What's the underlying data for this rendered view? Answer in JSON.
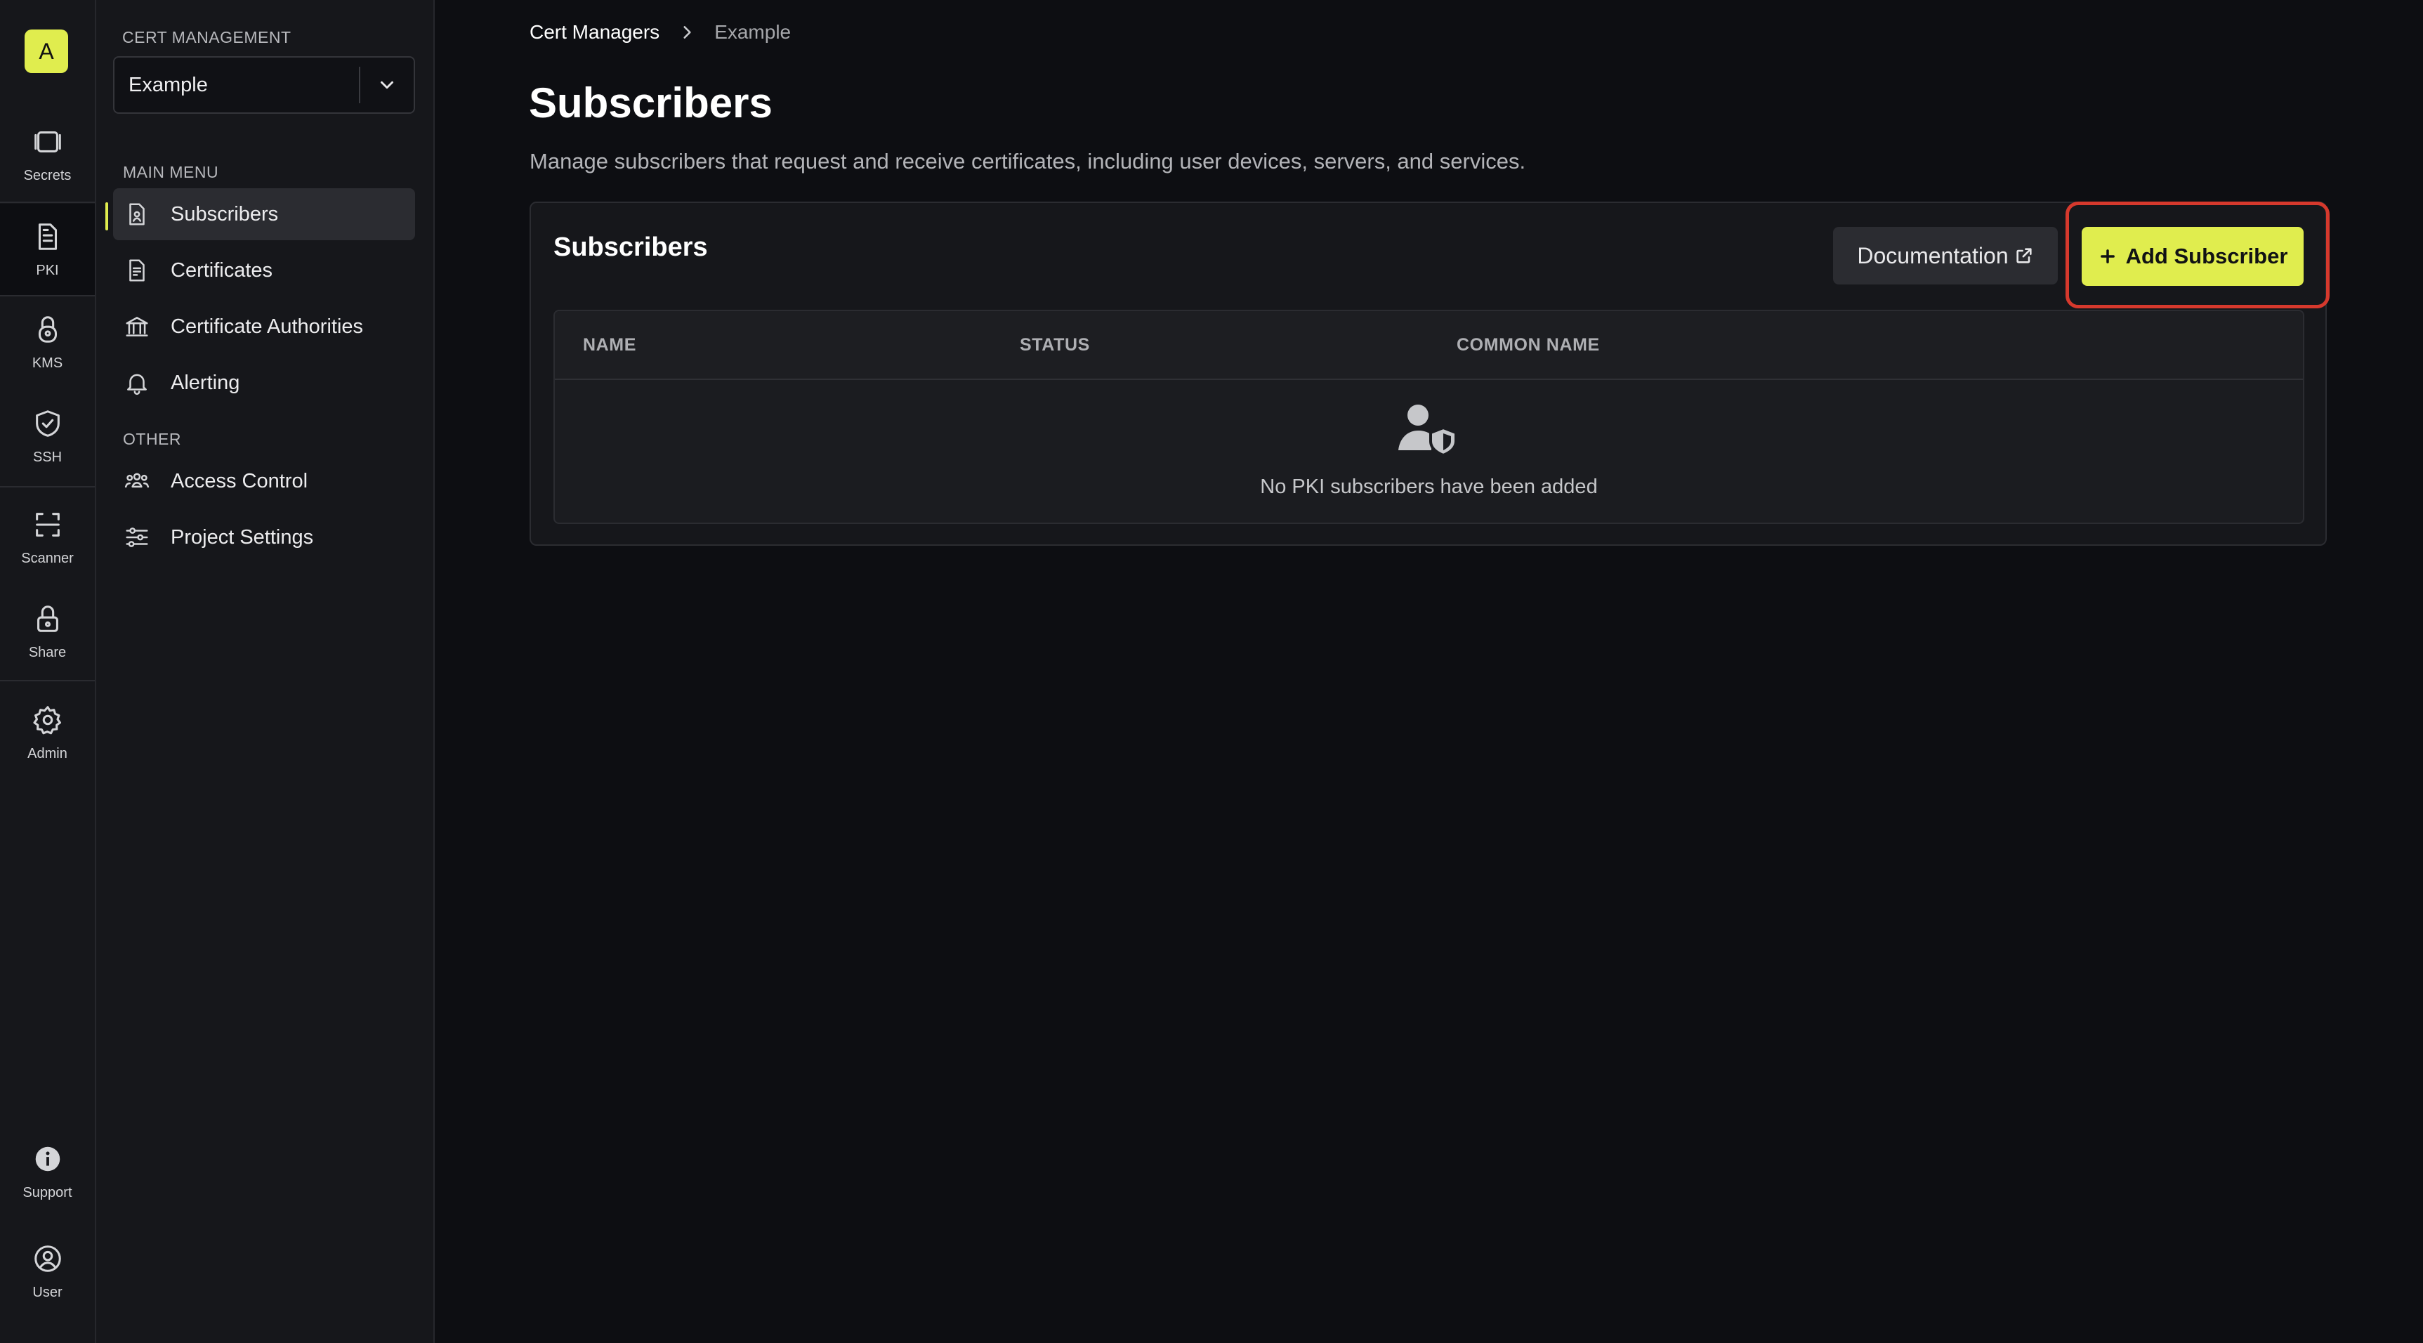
{
  "rail": {
    "avatar_letter": "A",
    "items": [
      {
        "label": "Secrets",
        "icon": "vault-icon"
      },
      {
        "label": "PKI",
        "icon": "document-icon",
        "active": true
      },
      {
        "label": "KMS",
        "icon": "key-lock-icon"
      },
      {
        "label": "SSH",
        "icon": "shield-check-icon"
      },
      {
        "label": "Scanner",
        "icon": "scan-icon"
      },
      {
        "label": "Share",
        "icon": "lock-icon"
      },
      {
        "label": "Admin",
        "icon": "gear-icon"
      },
      {
        "label": "Support",
        "icon": "info-icon"
      },
      {
        "label": "User",
        "icon": "user-circle-icon"
      }
    ]
  },
  "sidebar": {
    "section_title": "CERT MANAGEMENT",
    "project_select_value": "Example",
    "main_menu_heading": "MAIN MENU",
    "main_menu": [
      {
        "label": "Subscribers",
        "icon": "subscriber-doc-icon",
        "active": true
      },
      {
        "label": "Certificates",
        "icon": "certificate-icon"
      },
      {
        "label": "Certificate Authorities",
        "icon": "bank-icon"
      },
      {
        "label": "Alerting",
        "icon": "bell-icon"
      }
    ],
    "other_heading": "OTHER",
    "other_menu": [
      {
        "label": "Access Control",
        "icon": "users-icon"
      },
      {
        "label": "Project Settings",
        "icon": "sliders-icon"
      }
    ]
  },
  "breadcrumb": {
    "parent": "Cert Managers",
    "current": "Example"
  },
  "page": {
    "title": "Subscribers",
    "description": "Manage subscribers that request and receive certificates, including user devices, servers, and services."
  },
  "card": {
    "title": "Subscribers",
    "documentation_label": "Documentation",
    "add_label": "Add Subscriber",
    "columns": [
      "NAME",
      "STATUS",
      "COMMON NAME"
    ],
    "empty_text": "No PKI subscribers have been added"
  },
  "colors": {
    "accent": "#e0ed4e",
    "highlight": "#d6392d",
    "background": "#0d0e12",
    "panel": "#16171b"
  }
}
